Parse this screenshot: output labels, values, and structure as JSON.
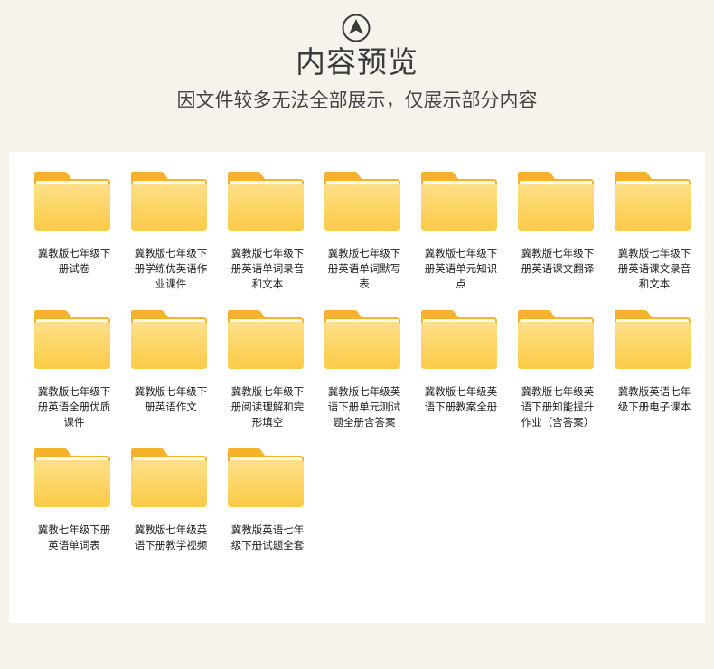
{
  "header": {
    "title": "内容预览",
    "subtitle": "因文件较多无法全部展示，仅展示部分内容",
    "logo_icon": "compass-arrow-icon"
  },
  "colors": {
    "page_background": "#f6f3ec",
    "panel_background": "#ffffff",
    "folder_back": "#f6b22b",
    "folder_front": "#fdd563"
  },
  "folders": [
    {
      "label": "冀教版七年级下册试卷",
      "icon": "folder-icon"
    },
    {
      "label": "冀教版七年级下册学练优英语作业课件",
      "icon": "folder-icon"
    },
    {
      "label": "冀教版七年级下册英语单词录音和文本",
      "icon": "folder-icon"
    },
    {
      "label": "冀教版七年级下册英语单词默写表",
      "icon": "folder-icon"
    },
    {
      "label": "冀教版七年级下册英语单元知识点",
      "icon": "folder-icon"
    },
    {
      "label": "冀教版七年级下册英语课文翻译",
      "icon": "folder-icon"
    },
    {
      "label": "冀教版七年级下册英语课文录音和文本",
      "icon": "folder-icon"
    },
    {
      "label": "冀教版七年级下册英语全册优质课件",
      "icon": "folder-icon"
    },
    {
      "label": "冀教版七年级下册英语作文",
      "icon": "folder-icon"
    },
    {
      "label": "冀教版七年级下册阅读理解和完形填空",
      "icon": "folder-icon"
    },
    {
      "label": "冀教版七年级英语下册单元测试题全册含答案",
      "icon": "folder-icon"
    },
    {
      "label": "冀教版七年级英语下册教案全册",
      "icon": "folder-icon"
    },
    {
      "label": "冀教版七年级英语下册知能提升作业（含答案）",
      "icon": "folder-icon"
    },
    {
      "label": "冀教版英语七年级下册电子课本",
      "icon": "folder-icon"
    },
    {
      "label": "冀教七年级下册英语单词表",
      "icon": "folder-icon"
    },
    {
      "label": "冀教版七年级英语下册教学视频",
      "icon": "folder-icon"
    },
    {
      "label": "冀教版英语七年级下册试题全套",
      "icon": "folder-icon"
    }
  ]
}
